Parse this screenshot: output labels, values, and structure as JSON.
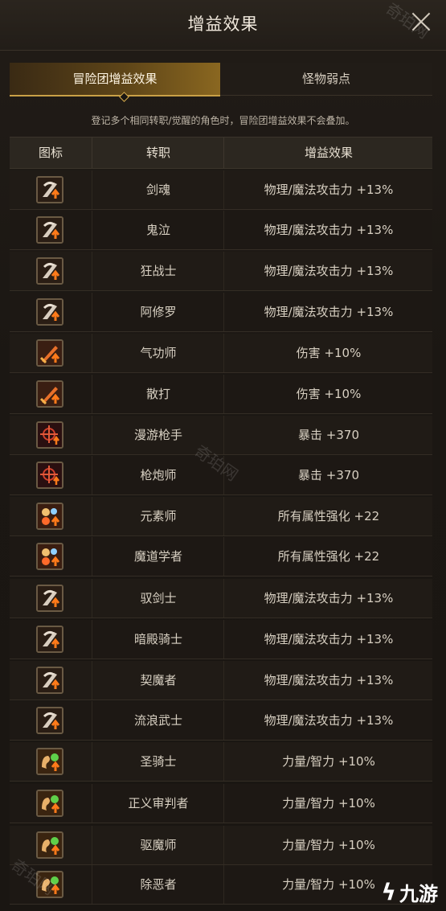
{
  "window": {
    "title": "增益效果"
  },
  "tabs": [
    {
      "label": "冒险团增益效果",
      "active": true
    },
    {
      "label": "怪物弱点",
      "active": false
    }
  ],
  "notice": "登记多个相同转职/觉醒的角色时，冒险团增益效果不会叠加。",
  "table": {
    "headers": [
      "图标",
      "转职",
      "增益效果"
    ],
    "rows": [
      {
        "icon": "blade-attack-up-icon",
        "job": "剑魂",
        "effect": "物理/魔法攻击力 +13%"
      },
      {
        "icon": "blade-attack-up-icon",
        "job": "鬼泣",
        "effect": "物理/魔法攻击力 +13%"
      },
      {
        "icon": "blade-attack-up-icon",
        "job": "狂战士",
        "effect": "物理/魔法攻击力 +13%"
      },
      {
        "icon": "blade-attack-up-icon",
        "job": "阿修罗",
        "effect": "物理/魔法攻击力 +13%"
      },
      {
        "icon": "sword-damage-up-icon",
        "job": "气功师",
        "effect": "伤害 +10%"
      },
      {
        "icon": "sword-damage-up-icon",
        "job": "散打",
        "effect": "伤害 +10%"
      },
      {
        "icon": "crosshair-crit-up-icon",
        "job": "漫游枪手",
        "effect": "暴击 +370"
      },
      {
        "icon": "crosshair-crit-up-icon",
        "job": "枪炮师",
        "effect": "暴击 +370"
      },
      {
        "icon": "element-up-icon",
        "job": "元素师",
        "effect": "所有属性强化 +22"
      },
      {
        "icon": "element-up-icon",
        "job": "魔道学者",
        "effect": "所有属性强化 +22"
      },
      {
        "icon": "blade-attack-up-icon",
        "job": "驭剑士",
        "effect": "物理/魔法攻击力 +13%"
      },
      {
        "icon": "blade-attack-up-icon",
        "job": "暗殿骑士",
        "effect": "物理/魔法攻击力 +13%"
      },
      {
        "icon": "blade-attack-up-icon",
        "job": "契魔者",
        "effect": "物理/魔法攻击力 +13%"
      },
      {
        "icon": "blade-attack-up-icon",
        "job": "流浪武士",
        "effect": "物理/魔法攻击力 +13%"
      },
      {
        "icon": "strength-int-up-icon",
        "job": "圣骑士",
        "effect": "力量/智力 +10%"
      },
      {
        "icon": "strength-int-up-icon",
        "job": "正义审判者",
        "effect": "力量/智力 +10%"
      },
      {
        "icon": "strength-int-up-icon",
        "job": "驱魔师",
        "effect": "力量/智力 +10%"
      },
      {
        "icon": "strength-int-up-icon",
        "job": "除恶者",
        "effect": "力量/智力 +10%"
      }
    ]
  },
  "watermarks": [
    "奇珀网",
    "奇珀网",
    "奇珀网"
  ],
  "logo": {
    "text": "九游"
  },
  "colors": {
    "accent": "#c9a046",
    "panel": "#1a1612",
    "text": "#d8d0c2"
  }
}
